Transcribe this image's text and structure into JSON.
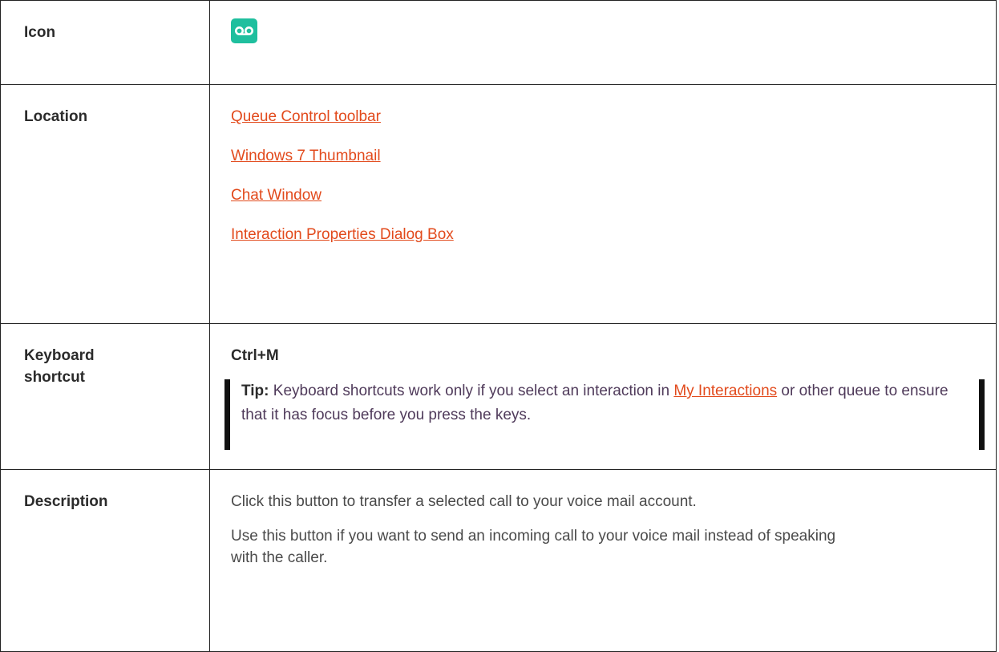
{
  "rows": {
    "icon": {
      "label": "Icon",
      "icon_name": "voicemail-icon",
      "icon_color": "#1fbf9e"
    },
    "location": {
      "label": "Location",
      "links": [
        "Queue Control toolbar",
        "Windows 7 Thumbnail",
        "Chat Window",
        "Interaction Properties Dialog Box"
      ]
    },
    "keyboard": {
      "label": "Keyboard shortcut",
      "shortcut": "Ctrl+M",
      "tip_label": "Tip:",
      "tip_text_before": "Keyboard shortcuts work only if you select an interaction in",
      "tip_link": "My Interactions",
      "tip_text_after": "or other queue to ensure that it has focus before you press the keys."
    },
    "description": {
      "label": "Description",
      "paragraphs": [
        "Click this button to transfer a selected call to your voice mail account.",
        "Use this button if you want to send an incoming call to your voice mail instead of speaking with the caller."
      ]
    }
  },
  "colors": {
    "link": "#e24a1c",
    "icon_bg": "#1fbf9e",
    "border": "#222222"
  }
}
